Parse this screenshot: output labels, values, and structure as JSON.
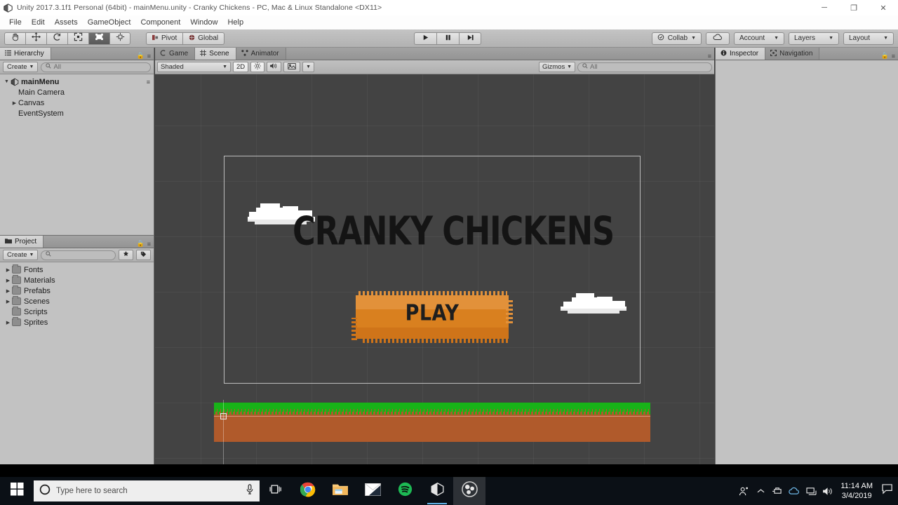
{
  "window": {
    "title": "Unity 2017.3.1f1 Personal (64bit) - mainMenu.unity - Cranky Chickens - PC, Mac & Linux Standalone <DX11>",
    "app_icon": "unity-icon",
    "minimize": "─",
    "maximize": "❐",
    "close": "✕"
  },
  "menubar": {
    "items": [
      {
        "label": "File"
      },
      {
        "label": "Edit"
      },
      {
        "label": "Assets"
      },
      {
        "label": "GameObject"
      },
      {
        "label": "Component"
      },
      {
        "label": "Window"
      },
      {
        "label": "Help"
      }
    ]
  },
  "toolbar": {
    "tools": [
      {
        "name": "hand-tool",
        "icon": "hand-icon",
        "active": false
      },
      {
        "name": "move-tool",
        "icon": "move-icon",
        "active": false
      },
      {
        "name": "rotate-tool",
        "icon": "rotate-icon",
        "active": false
      },
      {
        "name": "scale-tool",
        "icon": "scale-icon",
        "active": false
      },
      {
        "name": "rect-tool",
        "icon": "rect-transform-icon",
        "active": true
      },
      {
        "name": "transform-tool",
        "icon": "transform-icon",
        "active": false
      }
    ],
    "pivot_label": "Pivot",
    "space_label": "Global",
    "play_label": "Play",
    "pause_label": "Pause",
    "step_label": "Step",
    "collab_label": "Collab",
    "cloud_label": "Services",
    "account_label": "Account",
    "layers_label": "Layers",
    "layout_label": "Layout"
  },
  "hierarchy": {
    "tab_label": "Hierarchy",
    "create_label": "Create",
    "search_placeholder": "All",
    "scene_name": "mainMenu",
    "items": [
      {
        "label": "Main Camera",
        "expandable": false
      },
      {
        "label": "Canvas",
        "expandable": true
      },
      {
        "label": "EventSystem",
        "expandable": false
      }
    ]
  },
  "project": {
    "tab_label": "Project",
    "create_label": "Create",
    "search_placeholder": "",
    "folders": [
      {
        "label": "Fonts",
        "expandable": true
      },
      {
        "label": "Materials",
        "expandable": true
      },
      {
        "label": "Prefabs",
        "expandable": true
      },
      {
        "label": "Scenes",
        "expandable": true
      },
      {
        "label": "Scripts",
        "expandable": false
      },
      {
        "label": "Sprites",
        "expandable": true
      }
    ]
  },
  "sceneview": {
    "tabs": [
      {
        "label": "Game",
        "icon": "game-icon",
        "active": false
      },
      {
        "label": "Scene",
        "icon": "scene-icon",
        "active": true
      },
      {
        "label": "Animator",
        "icon": "animator-icon",
        "active": false
      }
    ],
    "draw_mode": "Shaded",
    "mode_2d": "2D",
    "lighting_icon": "sun-icon",
    "audio_icon": "speaker-icon",
    "effects_icon": "effects-icon",
    "gizmos_label": "Gizmos",
    "search_placeholder": "All",
    "scene_content": {
      "title_text": "CRANKY CHICKENS",
      "play_button_text": "PLAY",
      "clouds": 2,
      "colors": {
        "button_fill": "#d9801f",
        "button_highlight": "#e2913a",
        "button_shadow": "#cf7419",
        "grass": "#18b318",
        "dirt": "#b05a2b",
        "title": "#141414",
        "cloud": "#ffffff",
        "scene_background": "#434343"
      }
    }
  },
  "inspector": {
    "tabs": [
      {
        "label": "Inspector",
        "icon": "inspector-icon",
        "active": true
      },
      {
        "label": "Navigation",
        "icon": "navigation-icon",
        "active": false
      }
    ]
  },
  "taskbar": {
    "start_icon": "windows-start-icon",
    "cortana_icon": "cortana-circle-icon",
    "search_placeholder": "Type here to search",
    "mic_icon": "microphone-icon",
    "taskview_icon": "task-view-icon",
    "apps": [
      {
        "name": "chrome",
        "icon": "chrome-icon",
        "running": false,
        "focused": false
      },
      {
        "name": "file-explorer",
        "icon": "folder-icon",
        "running": false,
        "focused": false
      },
      {
        "name": "mail",
        "icon": "mail-icon",
        "running": false,
        "focused": false
      },
      {
        "name": "spotify",
        "icon": "spotify-icon",
        "running": false,
        "focused": false
      },
      {
        "name": "unity",
        "icon": "unity-icon",
        "running": true,
        "focused": false
      },
      {
        "name": "obs-studio",
        "icon": "obs-icon",
        "running": false,
        "focused": true
      }
    ],
    "tray": [
      {
        "name": "people",
        "icon": "people-icon"
      },
      {
        "name": "show-hidden",
        "icon": "chevron-up-icon"
      },
      {
        "name": "removable-media",
        "icon": "usb-eject-icon"
      },
      {
        "name": "onedrive",
        "icon": "cloud-icon"
      },
      {
        "name": "network",
        "icon": "network-icon"
      },
      {
        "name": "volume",
        "icon": "speaker-icon"
      }
    ],
    "clock_time": "11:14 AM",
    "clock_date": "3/4/2019",
    "notification_icon": "action-center-icon"
  }
}
